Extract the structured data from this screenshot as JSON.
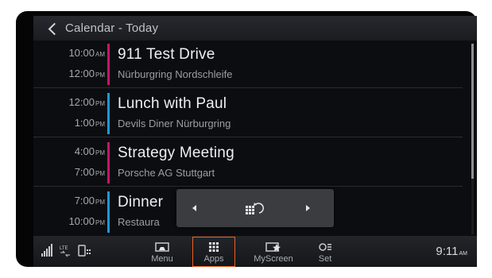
{
  "header": {
    "title": "Calendar - Today",
    "back_icon": "chevron-left-icon"
  },
  "events": [
    {
      "start": "10:00",
      "start_ampm": "AM",
      "end": "12:00",
      "end_ampm": "PM",
      "title": "911 Test Drive",
      "location": "Nürburgring Nordschleife",
      "color": "#c2186b"
    },
    {
      "start": "12:00",
      "start_ampm": "PM",
      "end": "1:00",
      "end_ampm": "PM",
      "title": "Lunch with Paul",
      "location": "Devils Diner Nürburgring",
      "color": "#1a9ad6"
    },
    {
      "start": "4:00",
      "start_ampm": "PM",
      "end": "7:00",
      "end_ampm": "PM",
      "title": "Strategy Meeting",
      "location": "Porsche AG Stuttgart",
      "color": "#c2186b"
    },
    {
      "start": "7:00",
      "start_ampm": "PM",
      "end": "10:00",
      "end_ampm": "PM",
      "title": "Dinner",
      "location": "Restaura",
      "color": "#1a9ad6"
    }
  ],
  "popup": {
    "left_icon": "arrow-left-icon",
    "center_icon": "apps-rotate-icon",
    "right_icon": "arrow-right-icon"
  },
  "bottom_bar": {
    "status_icons": [
      "signal-strength-icon",
      "lte-icon",
      "phone-status-icon"
    ],
    "tabs": [
      {
        "label": "Menu",
        "icon": "car-menu-icon"
      },
      {
        "label": "Apps",
        "icon": "apps-grid-icon",
        "selected": true
      },
      {
        "label": "MyScreen",
        "icon": "myscreen-star-icon"
      },
      {
        "label": "Set",
        "icon": "settings-icon"
      }
    ],
    "clock": "9:11",
    "clock_ampm": "AM"
  },
  "colors": {
    "accent": "#ef5f1e",
    "magenta": "#c2186b",
    "blue": "#1a9ad6"
  }
}
